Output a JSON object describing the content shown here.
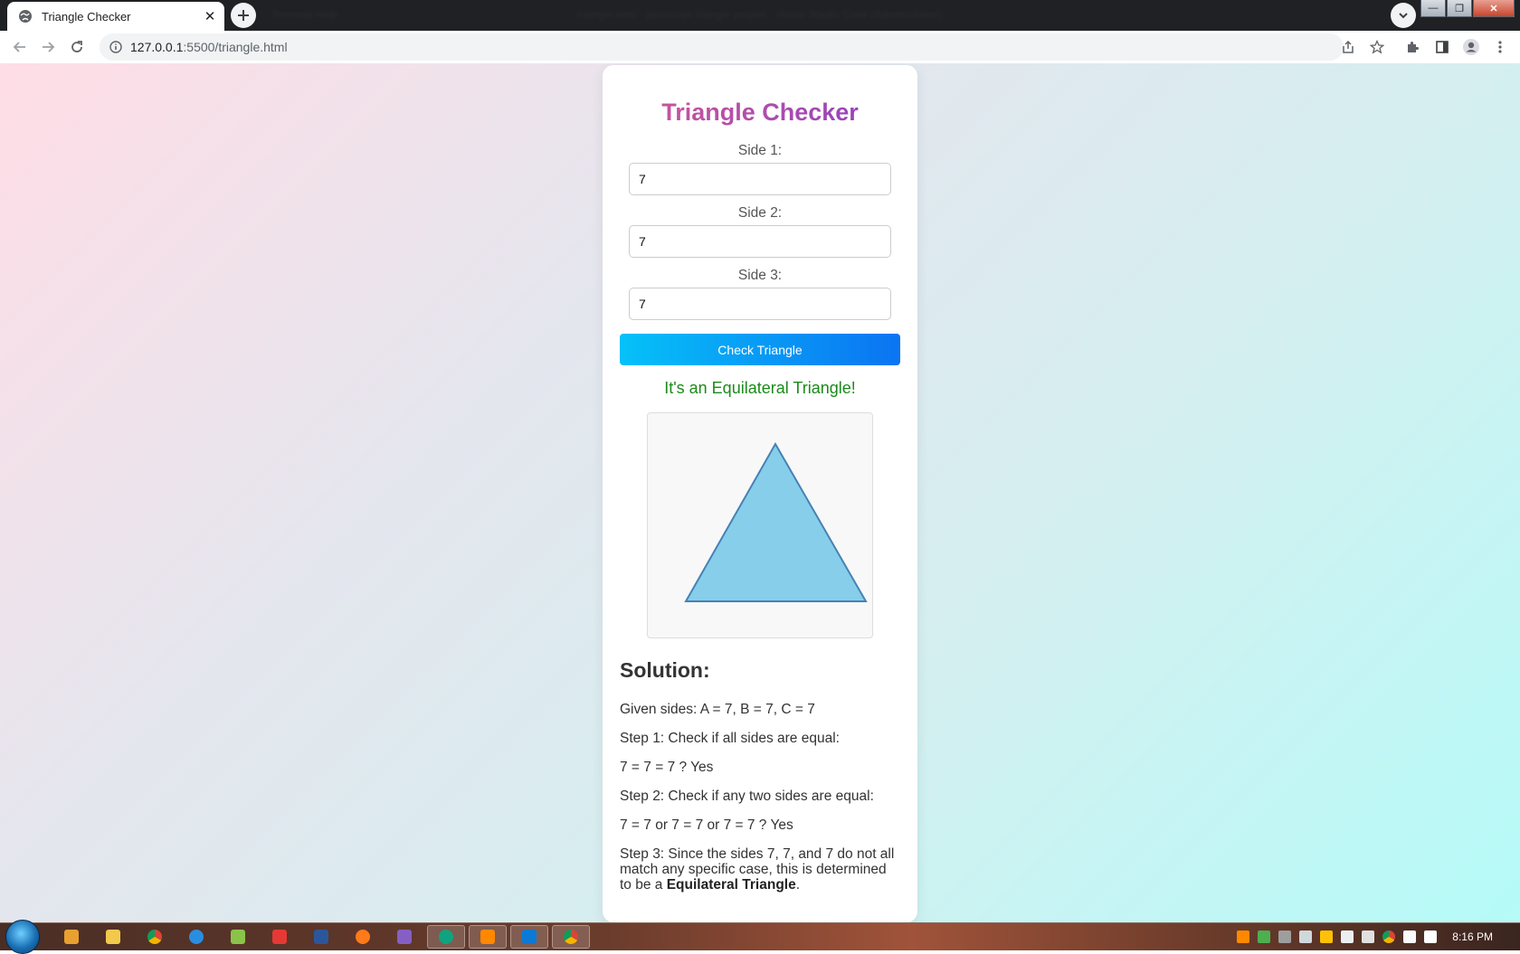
{
  "browser": {
    "tab_title": "Triangle Checker",
    "window_title_left": "Terminal   Help",
    "window_title_right": "triangle.html - javascript triangle project - Visual Studio Code (Administrator)",
    "url_host": "127.0.0.1",
    "url_rest": ":5500/triangle.html"
  },
  "page": {
    "title": "Triangle Checker",
    "side1_label": "Side 1:",
    "side1_value": "7",
    "side2_label": "Side 2:",
    "side2_value": "7",
    "side3_label": "Side 3:",
    "side3_value": "7",
    "button_label": "Check Triangle",
    "result": "It's an Equilateral Triangle!",
    "triangle": {
      "fill": "#87ceeb",
      "stroke": "#4682b4"
    },
    "solution": {
      "heading": "Solution:",
      "given": "Given sides: A = 7, B = 7, C = 7",
      "step1": "Step 1: Check if all sides are equal:",
      "step1_result": "7 = 7 = 7 ? Yes",
      "step2": "Step 2: Check if any two sides are equal:",
      "step2_result": "7 = 7 or 7 = 7 or 7 = 7 ? Yes",
      "step3_prefix": "Step 3: Since the sides 7, 7, and 7 do not all match any specific case, this is determined to be a",
      "step3_bold": "Equilateral Triangle",
      "step3_suffix": "."
    }
  },
  "taskbar": {
    "clock": "8:16 PM"
  },
  "colors": {
    "accent_button": "#0b74f2",
    "result_green": "#1a8a1a",
    "title_gradient_start": "#d45a94",
    "title_gradient_end": "#8a3fc4"
  }
}
